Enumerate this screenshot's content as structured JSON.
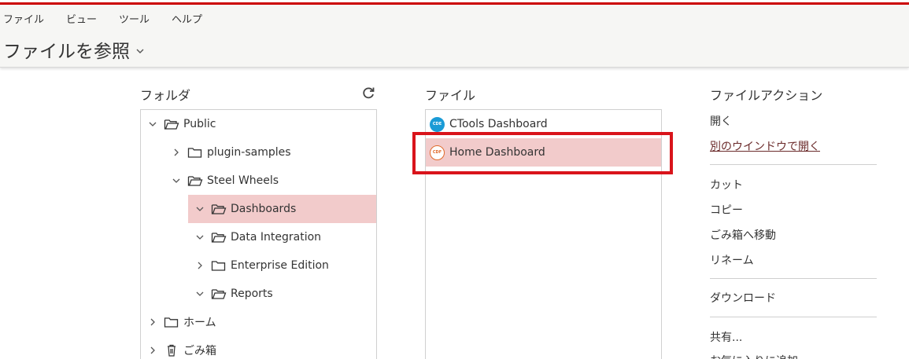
{
  "menu": {
    "file": "ファイル",
    "view": "ビュー",
    "tools": "ツール",
    "help": "ヘルプ"
  },
  "page": {
    "title": "ファイルを参照"
  },
  "folders": {
    "title": "フォルダ",
    "items": [
      {
        "label": "Public",
        "expanded": true,
        "selected": false
      },
      {
        "label": "plugin-samples",
        "expanded": false,
        "selected": false
      },
      {
        "label": "Steel Wheels",
        "expanded": true,
        "selected": false
      },
      {
        "label": "Dashboards",
        "expanded": true,
        "selected": true
      },
      {
        "label": "Data Integration",
        "expanded": true,
        "selected": false
      },
      {
        "label": "Enterprise Edition",
        "expanded": false,
        "selected": false
      },
      {
        "label": "Reports",
        "expanded": true,
        "selected": false
      },
      {
        "label": "ホーム",
        "expanded": false,
        "selected": false
      },
      {
        "label": "ごみ箱",
        "expanded": false,
        "selected": false
      }
    ]
  },
  "files": {
    "title": "ファイル",
    "items": [
      {
        "label": "CTools Dashboard",
        "badge": "CDE",
        "selected": false
      },
      {
        "label": "Home Dashboard",
        "badge": "CDF",
        "selected": true
      }
    ]
  },
  "actions": {
    "title": "ファイルアクション",
    "open": "開く",
    "open_new_window": "別のウインドウで開く",
    "cut": "カット",
    "copy": "コピー",
    "move_to_trash": "ごみ箱へ移動",
    "rename": "リネーム",
    "download": "ダウンロード",
    "share": "共有...",
    "add_favorite": "お気に入りに追加"
  },
  "colors": {
    "accent_bar": "#cc0000",
    "selection": "#f2cbcb",
    "highlight_box": "#d9141b",
    "cde_badge": "#1a9bd6",
    "cdf_badge": "#e06a2b"
  }
}
